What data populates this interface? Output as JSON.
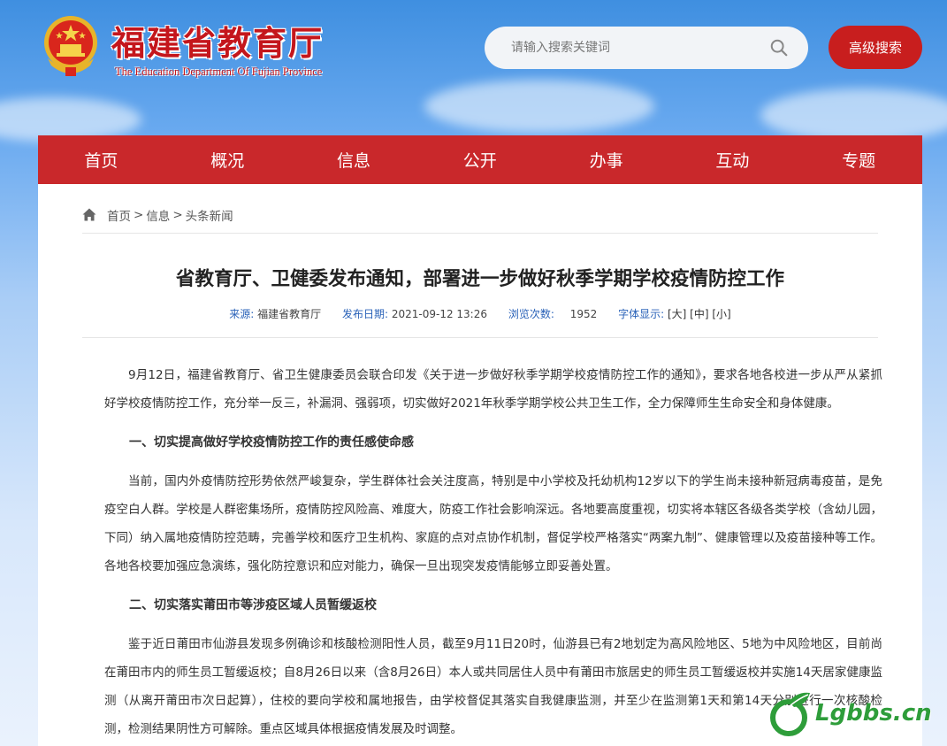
{
  "header": {
    "title": "福建省教育厅",
    "subtitle": "The Education Department Of Fujian Province",
    "search_placeholder": "请输入搜索关键词",
    "advanced_search": "高级搜索"
  },
  "nav": {
    "items": [
      "首页",
      "概况",
      "信息",
      "公开",
      "办事",
      "互动",
      "专题"
    ]
  },
  "breadcrumb": {
    "items": [
      "首页",
      "信息",
      "头条新闻"
    ],
    "separator": ">"
  },
  "article": {
    "title": "省教育厅、卫健委发布通知，部署进一步做好秋季学期学校疫情防控工作",
    "meta": {
      "source_label": "来源:",
      "source": "福建省教育厅",
      "date_label": "发布日期:",
      "date": "2021-09-12 13:26",
      "views_label": "浏览次数:",
      "views": "1952",
      "font_label": "字体显示:",
      "font_large": "[大]",
      "font_medium": "[中]",
      "font_small": "[小]"
    },
    "p1": "9月12日，福建省教育厅、省卫生健康委员会联合印发《关于进一步做好秋季学期学校疫情防控工作的通知》，要求各地各校进一步从严从紧抓好学校疫情防控工作，充分举一反三，补漏洞、强弱项，切实做好2021年秋季学期学校公共卫生工作，全力保障师生生命安全和身体健康。",
    "h1": "一、切实提高做好学校疫情防控工作的责任感使命感",
    "p2": "当前，国内外疫情防控形势依然严峻复杂，学生群体社会关注度高，特别是中小学校及托幼机构12岁以下的学生尚未接种新冠病毒疫苗，是免疫空白人群。学校是人群密集场所，疫情防控风险高、难度大，防疫工作社会影响深远。各地要高度重视，切实将本辖区各级各类学校（含幼儿园，下同）纳入属地疫情防控范畴，完善学校和医疗卫生机构、家庭的点对点协作机制，督促学校严格落实“两案九制”、健康管理以及疫苗接种等工作。各地各校要加强应急演练，强化防控意识和应对能力，确保一旦出现突发疫情能够立即妥善处置。",
    "h2": "二、切实落实莆田市等涉疫区域人员暂缓返校",
    "p3": "鉴于近日莆田市仙游县发现多例确诊和核酸检测阳性人员，截至9月11日20时，仙游县已有2地划定为高风险地区、5地为中风险地区，目前尚在莆田市内的师生员工暂缓返校；自8月26日以来（含8月26日）本人或共同居住人员中有莆田市旅居史的师生员工暂缓返校并实施14天居家健康监测（从离开莆田市次日起算），住校的要向学校和属地报告，由学校督促其落实自我健康监测，并至少在监测第1天和第14天分别进行一次核酸检测，检测结果阴性方可解除。重点区域具体根据疫情发展及时调整。"
  },
  "watermark": {
    "text": "Lgbbs.cn",
    "color": "#2e9d3a"
  },
  "colors": {
    "brand_red": "#c9282b",
    "link_blue": "#2a62b8"
  }
}
